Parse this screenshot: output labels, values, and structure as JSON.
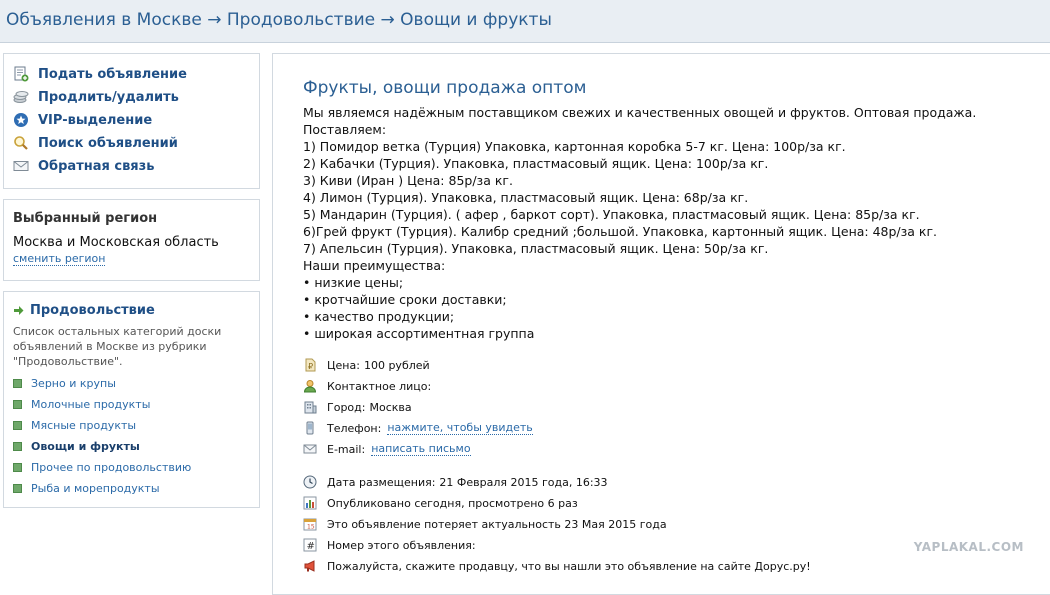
{
  "breadcrumb": {
    "part1": "Объявления в Москве",
    "sep": " → ",
    "part2": "Продовольствие",
    "part3": "Овощи и фрукты"
  },
  "actions": [
    {
      "label": "Подать объявление",
      "icon": "add-document-icon"
    },
    {
      "label": "Продлить/удалить",
      "icon": "coins-icon"
    },
    {
      "label": "VIP-выделение",
      "icon": "star-badge-icon"
    },
    {
      "label": "Поиск объявлений",
      "icon": "magnifier-icon"
    },
    {
      "label": "Обратная связь",
      "icon": "envelope-icon"
    }
  ],
  "region": {
    "title": "Выбранный регион",
    "name": "Москва и Московская область",
    "change_label": "сменить регион"
  },
  "category": {
    "title": "Продовольствие",
    "description": "Список остальных категорий доски объявлений в Москве из рубрики \"Продовольствие\".",
    "items": [
      {
        "label": "Зерно и крупы",
        "active": false
      },
      {
        "label": "Молочные продукты",
        "active": false
      },
      {
        "label": "Мясные продукты",
        "active": false
      },
      {
        "label": "Овощи и фрукты",
        "active": true
      },
      {
        "label": "Прочее по продовольствию",
        "active": false
      },
      {
        "label": "Рыба и морепродукты",
        "active": false
      }
    ]
  },
  "ad": {
    "title": "Фрукты, овощи продажа оптом",
    "lines": [
      "Мы являемся надёжным поставщиком свежих и качественных овощей и фруктов. Оптовая продажа.",
      "Поставляем:",
      "1) Помидор ветка (Турция) Упаковка, картонная коробка 5-7 кг. Цена: 100р/за кг.",
      "2) Кабачки (Турция). Упаковка, пластмасовый ящик. Цена: 100р/за кг.",
      "3) Киви (Иран ) Цена: 85р/за кг.",
      "4) Лимон (Турция). Упаковка, пластмасовый ящик. Цена: 68р/за кг.",
      "5) Мандарин (Турция). ( афер , баркот сорт). Упаковка, пластмасовый ящик. Цена: 85р/за кг.",
      "6)Грей фрукт (Турция). Калибр средний ;большой. Упаковка, картонный ящик. Цена: 48р/за кг.",
      "7) Апельсин (Турция). Упаковка, пластмасовый ящик. Цена: 50р/за кг.",
      "Наши преимущества:",
      "• низкие цены;",
      "• кротчайшие сроки доставки;",
      "• качество продукции;",
      "• широкая ассортиментная группа"
    ],
    "price_label": "Цена:",
    "price_value": "100 рублей",
    "contact_label": "Контактное лицо:",
    "city_label": "Город:",
    "city_value": "Москва",
    "phone_label": "Телефон:",
    "phone_link": "нажмите, чтобы увидеть",
    "email_label": "E-mail:",
    "email_link": "написать письмо",
    "date_label": "Дата размещения:",
    "date_value": "21 Февраля 2015 года, 16:33",
    "published": "Опубликовано сегодня, просмотрено 6 раз",
    "expires": "Это объявление потеряет актуальность 23 Мая 2015 года",
    "number_label": "Номер этого объявления:",
    "tell_seller": "Пожалуйста, скажите продавцу, что вы нашли это объявление на сайте Дорус.ру!"
  },
  "watermark": "YAPLAKAL.COM",
  "colors": {
    "link": "#2b6aa8",
    "heading": "#2b5f93",
    "topbar_bg": "#e9eef3"
  }
}
